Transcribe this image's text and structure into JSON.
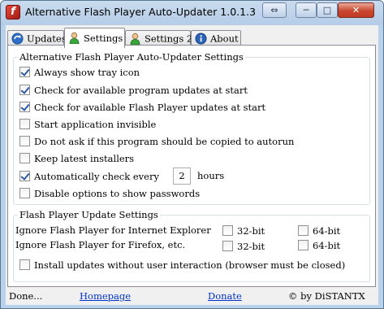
{
  "window": {
    "title": "Alternative Flash Player Auto-Updater 1.0.1.3",
    "app_icon_glyph": "f",
    "buttons": {
      "restore_glyph": "⇔",
      "minimize_glyph": "─",
      "maximize_glyph": "□",
      "close_glyph": "✕"
    }
  },
  "tabs": [
    {
      "label": "Updates",
      "icon": "globe-update-icon",
      "active": false
    },
    {
      "label": "Settings",
      "icon": "user-settings-icon",
      "active": true
    },
    {
      "label": "Settings 2",
      "icon": "user-settings-icon",
      "active": false
    },
    {
      "label": "About",
      "icon": "info-icon",
      "active": false
    }
  ],
  "general_group": {
    "title": "Alternative Flash Player Auto-Updater Settings",
    "options": [
      {
        "label": "Always show tray icon",
        "checked": true
      },
      {
        "label": "Check for available program updates at start",
        "checked": true
      },
      {
        "label": "Check for available Flash Player updates at start",
        "checked": true
      },
      {
        "label": "Start application invisible",
        "checked": false
      },
      {
        "label": "Do not ask if this program should be copied to autorun",
        "checked": false
      },
      {
        "label": "Keep latest installers",
        "checked": false
      },
      {
        "label": "Automatically check every",
        "checked": true
      },
      {
        "label": "Disable options to show passwords",
        "checked": false
      }
    ],
    "interval_value": "2",
    "interval_unit": "hours"
  },
  "flash_group": {
    "title": "Flash Player Update Settings",
    "rows": [
      {
        "label": "Ignore Flash Player for Internet Explorer",
        "bit32": "32-bit",
        "bit64": "64-bit",
        "checked32": false,
        "checked64": false
      },
      {
        "label": "Ignore Flash Player for Firefox, etc.",
        "bit32": "32-bit",
        "bit64": "64-bit",
        "checked32": false,
        "checked64": false
      }
    ],
    "silent_install": {
      "label": "Install updates without user interaction (browser must be closed)",
      "checked": false
    }
  },
  "status": {
    "text": "Done...",
    "homepage_link": "Homepage",
    "donate_link": "Donate",
    "copyright": "© by DiSTANTX"
  }
}
